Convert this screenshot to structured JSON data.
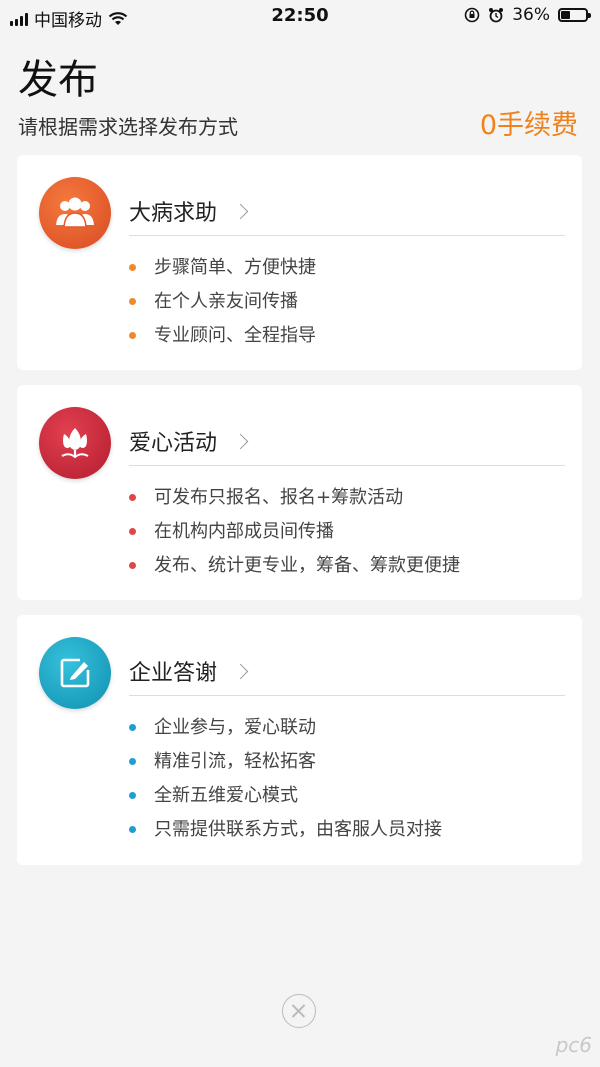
{
  "status_bar": {
    "carrier": "中国移动",
    "time": "22:50",
    "battery_percent": "36%",
    "battery_level": 0.36,
    "icons": [
      "signal-icon",
      "wifi-icon",
      "rotation-lock-icon",
      "alarm-icon",
      "battery-icon"
    ]
  },
  "header": {
    "title": "发布",
    "subtitle": "请根据需求选择发布方式",
    "fee_label": "0手续费"
  },
  "cards": [
    {
      "title": "大病求助",
      "icon": "people-icon",
      "icon_color": "#e8582c",
      "dot_color": "#f08a24",
      "features": [
        "步骤简单、方便快捷",
        "在个人亲友间传播",
        "专业顾问、全程指导"
      ]
    },
    {
      "title": "爱心活动",
      "icon": "tulip-icon",
      "icon_color": "#c8283a",
      "dot_color": "#e04646",
      "features": [
        "可发布只报名、报名+筹款活动",
        "在机构内部成员间传播",
        "发布、统计更专业，筹备、筹款更便捷"
      ]
    },
    {
      "title": "企业答谢",
      "icon": "edit-icon",
      "icon_color": "#1aa6c6",
      "dot_color": "#1e9ed6",
      "features": [
        "企业参与，爱心联动",
        "精准引流，轻松拓客",
        "全新五维爱心模式",
        "只需提供联系方式，由客服人员对接"
      ]
    }
  ],
  "footer": {
    "close_icon": "close-icon",
    "watermark": "pc6"
  }
}
